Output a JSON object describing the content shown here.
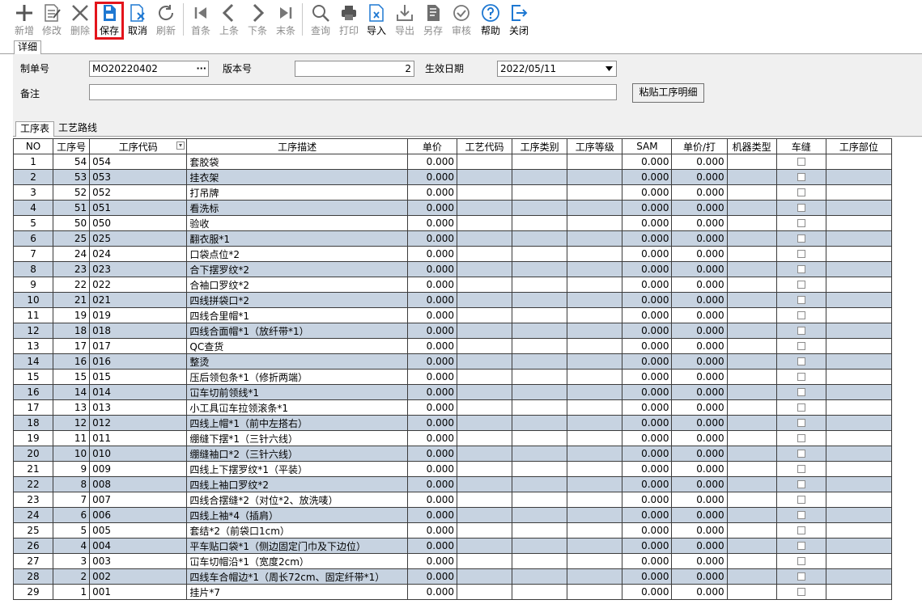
{
  "toolbar": {
    "buttons": [
      {
        "label": "新增",
        "icon": "plus-icon",
        "enabled": false
      },
      {
        "label": "修改",
        "icon": "edit-document-icon",
        "enabled": false
      },
      {
        "label": "删除",
        "icon": "close-x-icon",
        "enabled": false
      },
      {
        "label": "保存",
        "icon": "save-icon",
        "enabled": true
      },
      {
        "label": "取消",
        "icon": "cancel-document-icon",
        "enabled": true
      },
      {
        "label": "刷新",
        "icon": "refresh-icon",
        "enabled": false
      },
      {
        "label": "首条",
        "icon": "first-record-icon",
        "enabled": false
      },
      {
        "label": "上条",
        "icon": "previous-record-icon",
        "enabled": false
      },
      {
        "label": "下条",
        "icon": "next-record-icon",
        "enabled": false
      },
      {
        "label": "末条",
        "icon": "last-record-icon",
        "enabled": false
      },
      {
        "label": "查询",
        "icon": "search-icon",
        "enabled": false
      },
      {
        "label": "打印",
        "icon": "printer-icon",
        "enabled": false
      },
      {
        "label": "导入",
        "icon": "import-excel-icon",
        "enabled": true
      },
      {
        "label": "导出",
        "icon": "export-icon",
        "enabled": false
      },
      {
        "label": "另存",
        "icon": "save-as-icon",
        "enabled": false
      },
      {
        "label": "审核",
        "icon": "approve-check-icon",
        "enabled": false
      },
      {
        "label": "帮助",
        "icon": "help-icon",
        "enabled": true
      },
      {
        "label": "关闭",
        "icon": "exit-icon",
        "enabled": true
      }
    ],
    "highlight_color": "#e3141b",
    "highlighted_button": "保存"
  },
  "outer_tab": {
    "label": "详细"
  },
  "form": {
    "order_no_label": "制单号",
    "order_no_value": "MO20220402",
    "lookup_button": "···",
    "version_label": "版本号",
    "version_value": "2",
    "effective_date_label": "生效日期",
    "effective_date_value": "2022/05/11",
    "remark_label": "备注",
    "remark_value": "",
    "paste_button": "粘贴工序明细"
  },
  "inner_tabs": [
    {
      "label": "工序表",
      "active": true
    },
    {
      "label": "工艺路线",
      "active": false
    }
  ],
  "grid": {
    "columns": [
      "NO",
      "工序号",
      "工序代码",
      "工序描述",
      "单价",
      "工艺代码",
      "工序类别",
      "工序等级",
      "SAM",
      "单价/打",
      "机器类型",
      "车缝",
      "工序部位"
    ],
    "row_stripe_color": "#c7d3e1",
    "rows": [
      {
        "no": "1",
        "seq": "54",
        "code": "054",
        "desc": "套胶袋",
        "price": "0.000",
        "sam": "0.000",
        "dozen": "0.000"
      },
      {
        "no": "2",
        "seq": "53",
        "code": "053",
        "desc": "挂衣架",
        "price": "0.000",
        "sam": "0.000",
        "dozen": "0.000"
      },
      {
        "no": "3",
        "seq": "52",
        "code": "052",
        "desc": "打吊牌",
        "price": "0.000",
        "sam": "0.000",
        "dozen": "0.000"
      },
      {
        "no": "4",
        "seq": "51",
        "code": "051",
        "desc": "看洗标",
        "price": "0.000",
        "sam": "0.000",
        "dozen": "0.000"
      },
      {
        "no": "5",
        "seq": "50",
        "code": "050",
        "desc": "验收",
        "price": "0.000",
        "sam": "0.000",
        "dozen": "0.000"
      },
      {
        "no": "6",
        "seq": "25",
        "code": "025",
        "desc": "翻衣服*1",
        "price": "0.000",
        "sam": "0.000",
        "dozen": "0.000"
      },
      {
        "no": "7",
        "seq": "24",
        "code": "024",
        "desc": "口袋点位*2",
        "price": "0.000",
        "sam": "0.000",
        "dozen": "0.000"
      },
      {
        "no": "8",
        "seq": "23",
        "code": "023",
        "desc": "合下摆罗纹*2",
        "price": "0.000",
        "sam": "0.000",
        "dozen": "0.000"
      },
      {
        "no": "9",
        "seq": "22",
        "code": "022",
        "desc": "合袖口罗纹*2",
        "price": "0.000",
        "sam": "0.000",
        "dozen": "0.000"
      },
      {
        "no": "10",
        "seq": "21",
        "code": "021",
        "desc": "四线拼袋口*2",
        "price": "0.000",
        "sam": "0.000",
        "dozen": "0.000"
      },
      {
        "no": "11",
        "seq": "19",
        "code": "019",
        "desc": "四线合里帽*1",
        "price": "0.000",
        "sam": "0.000",
        "dozen": "0.000"
      },
      {
        "no": "12",
        "seq": "18",
        "code": "018",
        "desc": "四线合面帽*1（放纤带*1）",
        "price": "0.000",
        "sam": "0.000",
        "dozen": "0.000"
      },
      {
        "no": "13",
        "seq": "17",
        "code": "017",
        "desc": "QC查货",
        "price": "0.000",
        "sam": "0.000",
        "dozen": "0.000"
      },
      {
        "no": "14",
        "seq": "16",
        "code": "016",
        "desc": "整烫",
        "price": "0.000",
        "sam": "0.000",
        "dozen": "0.000"
      },
      {
        "no": "15",
        "seq": "15",
        "code": "015",
        "desc": "压后领包条*1（修折两端）",
        "price": "0.000",
        "sam": "0.000",
        "dozen": "0.000"
      },
      {
        "no": "16",
        "seq": "14",
        "code": "014",
        "desc": "冚车切前领线*1",
        "price": "0.000",
        "sam": "0.000",
        "dozen": "0.000"
      },
      {
        "no": "17",
        "seq": "13",
        "code": "013",
        "desc": "小工具冚车拉领滚条*1",
        "price": "0.000",
        "sam": "0.000",
        "dozen": "0.000"
      },
      {
        "no": "18",
        "seq": "12",
        "code": "012",
        "desc": "四线上帽*1（前中左搭右）",
        "price": "0.000",
        "sam": "0.000",
        "dozen": "0.000"
      },
      {
        "no": "19",
        "seq": "11",
        "code": "011",
        "desc": "绷缝下摆*1（三针六线）",
        "price": "0.000",
        "sam": "0.000",
        "dozen": "0.000"
      },
      {
        "no": "20",
        "seq": "10",
        "code": "010",
        "desc": "绷缝袖口*2（三针六线）",
        "price": "0.000",
        "sam": "0.000",
        "dozen": "0.000"
      },
      {
        "no": "21",
        "seq": "9",
        "code": "009",
        "desc": "四线上下摆罗纹*1（平装）",
        "price": "0.000",
        "sam": "0.000",
        "dozen": "0.000"
      },
      {
        "no": "22",
        "seq": "8",
        "code": "008",
        "desc": "四线上袖口罗纹*2",
        "price": "0.000",
        "sam": "0.000",
        "dozen": "0.000"
      },
      {
        "no": "23",
        "seq": "7",
        "code": "007",
        "desc": "四线合摆缝*2（对位*2、放洗唛）",
        "price": "0.000",
        "sam": "0.000",
        "dozen": "0.000"
      },
      {
        "no": "24",
        "seq": "6",
        "code": "006",
        "desc": "四线上袖*4（插肩）",
        "price": "0.000",
        "sam": "0.000",
        "dozen": "0.000"
      },
      {
        "no": "25",
        "seq": "5",
        "code": "005",
        "desc": "套结*2（前袋口1cm）",
        "price": "0.000",
        "sam": "0.000",
        "dozen": "0.000"
      },
      {
        "no": "26",
        "seq": "4",
        "code": "004",
        "desc": "平车贴口袋*1（侧边固定门巾及下边位）",
        "price": "0.000",
        "sam": "0.000",
        "dozen": "0.000"
      },
      {
        "no": "27",
        "seq": "3",
        "code": "003",
        "desc": "冚车切帽沿*1（宽度2cm）",
        "price": "0.000",
        "sam": "0.000",
        "dozen": "0.000"
      },
      {
        "no": "28",
        "seq": "2",
        "code": "002",
        "desc": "四线车合帽边*1（周长72cm、固定纤带*1）",
        "price": "0.000",
        "sam": "0.000",
        "dozen": "0.000"
      },
      {
        "no": "29",
        "seq": "1",
        "code": "001",
        "desc": "挂片*7",
        "price": "0.000",
        "sam": "0.000",
        "dozen": "0.000"
      }
    ]
  }
}
